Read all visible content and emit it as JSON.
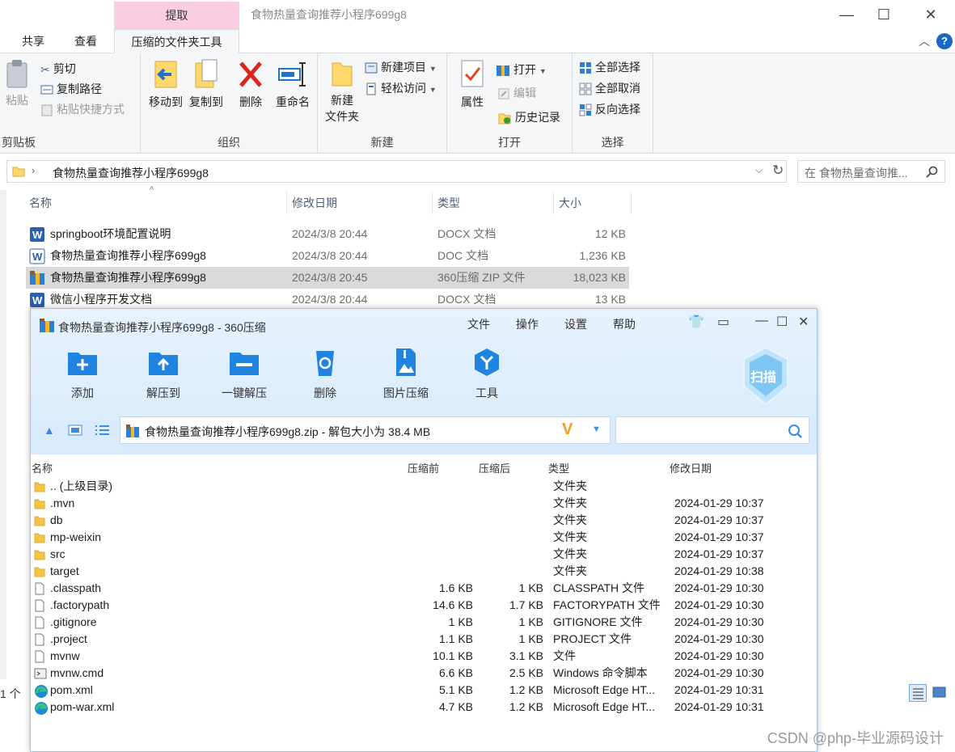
{
  "explorer": {
    "title": "食物热量查询推荐小程序699g8",
    "context_tab": "提取",
    "tabs": [
      "共享",
      "查看",
      "压缩的文件夹工具"
    ],
    "ribbon": {
      "clipboard": {
        "paste": "粘贴",
        "cut": "剪切",
        "copy_path": "复制路径",
        "paste_shortcut": "粘贴快捷方式",
        "label": "剪贴板"
      },
      "organize": {
        "move_to": "移动到",
        "copy_to": "复制到",
        "delete": "删除",
        "rename": "重命名",
        "label": "组织"
      },
      "new": {
        "new_folder_1": "新建",
        "new_folder_2": "文件夹",
        "new_item": "新建项目",
        "easy_access": "轻松访问",
        "label": "新建"
      },
      "open": {
        "properties": "属性",
        "open": "打开",
        "edit": "编辑",
        "history": "历史记录",
        "label": "打开"
      },
      "select": {
        "select_all": "全部选择",
        "select_none": "全部取消",
        "invert": "反向选择",
        "label": "选择"
      }
    },
    "address": "食物热量查询推荐小程序699g8",
    "search_placeholder": "在 食物热量查询推...",
    "columns": {
      "name": "名称",
      "date": "修改日期",
      "type": "类型",
      "size": "大小"
    },
    "files": [
      {
        "name": "springboot环境配置说明",
        "date": "2024/3/8 20:44",
        "type": "DOCX 文档",
        "size": "12 KB",
        "icon": "word-icon"
      },
      {
        "name": "食物热量查询推荐小程序699g8",
        "date": "2024/3/8 20:44",
        "type": "DOC 文档",
        "size": "1,236 KB",
        "icon": "word-icon"
      },
      {
        "name": "食物热量查询推荐小程序699g8",
        "date": "2024/3/8 20:45",
        "type": "360压缩 ZIP 文件",
        "size": "18,023 KB",
        "icon": "zip-icon"
      },
      {
        "name": "微信小程序开发文档",
        "date": "2024/3/8 20:44",
        "type": "DOCX 文档",
        "size": "13 KB",
        "icon": "word-icon"
      }
    ],
    "status": "1 个"
  },
  "zip": {
    "title": "食物热量查询推荐小程序699g8 - 360压缩",
    "menu": [
      "文件",
      "操作",
      "设置",
      "帮助"
    ],
    "tools": [
      "添加",
      "解压到",
      "一键解压",
      "删除",
      "图片压缩",
      "工具"
    ],
    "scan": "扫描",
    "path": "食物热量查询推荐小程序699g8.zip - 解包大小为 38.4 MB",
    "columns": {
      "name": "名称",
      "before": "压缩前",
      "after": "压缩后",
      "type": "类型",
      "date": "修改日期"
    },
    "rows": [
      {
        "name": ".. (上级目录)",
        "before": "",
        "after": "",
        "type": "文件夹",
        "date": "",
        "icon": "folder-icon"
      },
      {
        "name": ".mvn",
        "before": "",
        "after": "",
        "type": "文件夹",
        "date": "2024-01-29 10:37",
        "icon": "folder-icon"
      },
      {
        "name": "db",
        "before": "",
        "after": "",
        "type": "文件夹",
        "date": "2024-01-29 10:37",
        "icon": "folder-icon"
      },
      {
        "name": "mp-weixin",
        "before": "",
        "after": "",
        "type": "文件夹",
        "date": "2024-01-29 10:37",
        "icon": "folder-icon"
      },
      {
        "name": "src",
        "before": "",
        "after": "",
        "type": "文件夹",
        "date": "2024-01-29 10:37",
        "icon": "folder-icon"
      },
      {
        "name": "target",
        "before": "",
        "after": "",
        "type": "文件夹",
        "date": "2024-01-29 10:38",
        "icon": "folder-icon"
      },
      {
        "name": ".classpath",
        "before": "1.6 KB",
        "after": "1 KB",
        "type": "CLASSPATH 文件",
        "date": "2024-01-29 10:30",
        "icon": "file-icon"
      },
      {
        "name": ".factorypath",
        "before": "14.6 KB",
        "after": "1.7 KB",
        "type": "FACTORYPATH 文件",
        "date": "2024-01-29 10:30",
        "icon": "file-icon"
      },
      {
        "name": ".gitignore",
        "before": "1 KB",
        "after": "1 KB",
        "type": "GITIGNORE 文件",
        "date": "2024-01-29 10:30",
        "icon": "file-icon"
      },
      {
        "name": ".project",
        "before": "1.1 KB",
        "after": "1 KB",
        "type": "PROJECT 文件",
        "date": "2024-01-29 10:30",
        "icon": "file-icon"
      },
      {
        "name": "mvnw",
        "before": "10.1 KB",
        "after": "3.1 KB",
        "type": "文件",
        "date": "2024-01-29 10:30",
        "icon": "file-icon"
      },
      {
        "name": "mvnw.cmd",
        "before": "6.6 KB",
        "after": "2.5 KB",
        "type": "Windows 命令脚本",
        "date": "2024-01-29 10:30",
        "icon": "cmd-icon"
      },
      {
        "name": "pom.xml",
        "before": "5.1 KB",
        "after": "1.2 KB",
        "type": "Microsoft Edge HT...",
        "date": "2024-01-29 10:31",
        "icon": "edge-icon"
      },
      {
        "name": "pom-war.xml",
        "before": "4.7 KB",
        "after": "1.2 KB",
        "type": "Microsoft Edge HT...",
        "date": "2024-01-29 10:31",
        "icon": "edge-icon"
      }
    ]
  },
  "watermark": "CSDN @php-毕业源码设计"
}
